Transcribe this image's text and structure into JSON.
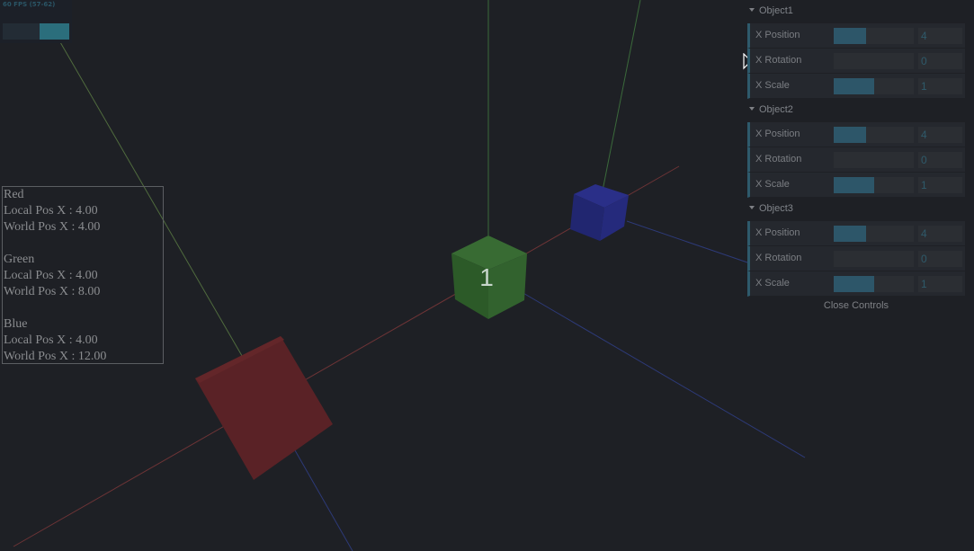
{
  "stats": {
    "fps_text": "60 FPS (57-62)",
    "graph_fill": 0.45
  },
  "info": {
    "lines": [
      "Red",
      "Local Pos X : 4.00",
      "World Pos X : 4.00",
      "",
      "Green",
      "Local Pos X : 4.00",
      "World Pos X : 8.00",
      "",
      "Blue",
      "Local Pos X : 4.00",
      "World Pos X : 12.00"
    ]
  },
  "scene": {
    "green_cube_label": "1",
    "colors": {
      "background": "#1e2025",
      "red_cube": "#5a2226",
      "green_cube": "#2f5e2b",
      "blue_cube": "#24297a",
      "axis_red": "#7a3a3a",
      "axis_green": "#3d6a3d",
      "axis_blue": "#2e3a7a"
    }
  },
  "gui": {
    "folders": [
      {
        "title": "Object1",
        "controls": [
          {
            "label": "X Position",
            "value": "4",
            "fill": 0.4
          },
          {
            "label": "X Rotation",
            "value": "0",
            "fill": 0.0
          },
          {
            "label": "X Scale",
            "value": "1",
            "fill": 0.5
          }
        ]
      },
      {
        "title": "Object2",
        "controls": [
          {
            "label": "X Position",
            "value": "4",
            "fill": 0.4
          },
          {
            "label": "X Rotation",
            "value": "0",
            "fill": 0.0
          },
          {
            "label": "X Scale",
            "value": "1",
            "fill": 0.5
          }
        ]
      },
      {
        "title": "Object3",
        "controls": [
          {
            "label": "X Position",
            "value": "4",
            "fill": 0.4
          },
          {
            "label": "X Rotation",
            "value": "0",
            "fill": 0.0
          },
          {
            "label": "X Scale",
            "value": "1",
            "fill": 0.5
          }
        ]
      }
    ],
    "close_label": "Close Controls"
  }
}
